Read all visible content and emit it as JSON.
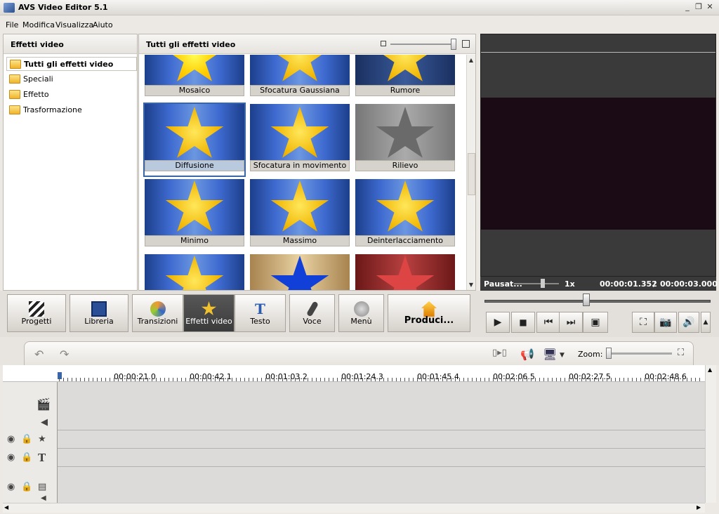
{
  "window": {
    "title": "AVS Video Editor 5.1",
    "min_label": "_",
    "restore_label": "❐",
    "close_label": "✕"
  },
  "menu": [
    "File",
    "Modifica",
    "Visualizza",
    "Aiuto"
  ],
  "left_panel": {
    "title": "Effetti video",
    "items": [
      "Tutti gli effetti video",
      "Speciali",
      "Effetto",
      "Trasformazione"
    ]
  },
  "center_panel": {
    "title": "Tutti gli effetti video",
    "effects": [
      "Mosaico",
      "Sfocatura Gaussiana",
      "Rumore",
      "Diffusione",
      "Sfocatura in movimento",
      "Rilievo",
      "Minimo",
      "Massimo",
      "Deinterlacciamento"
    ],
    "selected": "Diffusione"
  },
  "preview": {
    "status": "Pausat...",
    "speed": "1x",
    "time_current": "00:00:01.352",
    "time_separator": "/",
    "time_total": "00:00:03.000"
  },
  "toolbar": {
    "buttons": [
      "Progetti",
      "Libreria",
      "Transizioni",
      "Effetti video",
      "Testo",
      "Voce",
      "Menù",
      "Produci..."
    ],
    "active": "Effetti video"
  },
  "playback": {
    "play": "▶",
    "stop": "■",
    "prev": "⏮",
    "next": "⏭",
    "clip": "▣",
    "fullscreen": "⛶",
    "snapshot": "📷",
    "volume": "🔊",
    "expand": "▲"
  },
  "timeline": {
    "zoom_label": "Zoom:",
    "ticks": [
      "00:00:21.0",
      "00:00:42.1",
      "00:01:03.2",
      "00:01:24.3",
      "00:01:45.4",
      "00:02:06.5",
      "00:02:27.5",
      "00:02:48.6"
    ]
  }
}
